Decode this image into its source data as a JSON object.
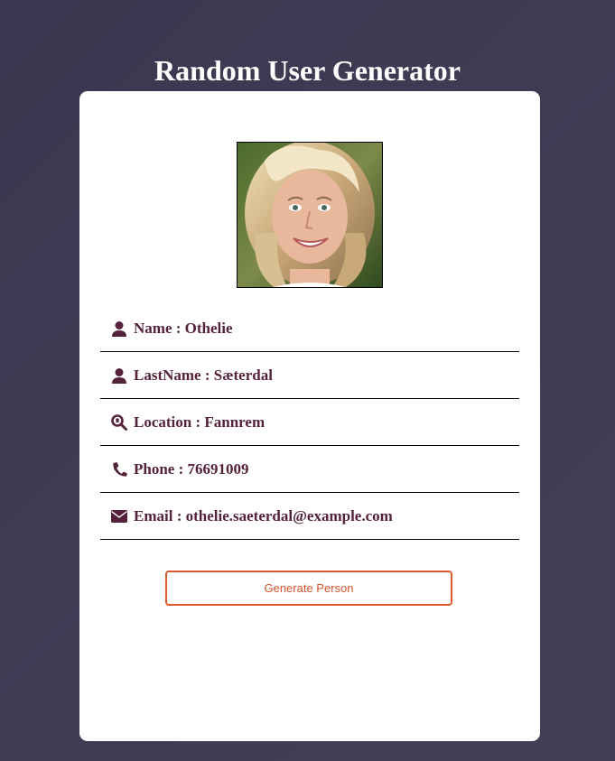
{
  "page": {
    "title": "Random User Generator"
  },
  "user": {
    "photo_icon": "user-portrait",
    "fields": [
      {
        "icon": "user-icon",
        "label": "Name : Othelie"
      },
      {
        "icon": "user-icon",
        "label": "LastName : Sæterdal"
      },
      {
        "icon": "location-search-icon",
        "label": "Location : Fannrem"
      },
      {
        "icon": "phone-icon",
        "label": "Phone : 76691009"
      },
      {
        "icon": "envelope-icon",
        "label": "Email : othelie.saeterdal@example.com"
      }
    ]
  },
  "actions": {
    "generate_label": "Generate Person"
  },
  "colors": {
    "background": "#3d3a52",
    "card": "#ffffff",
    "text": "#55223c",
    "accent": "#e0582a"
  }
}
